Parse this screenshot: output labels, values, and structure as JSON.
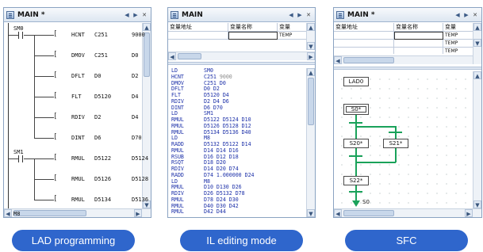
{
  "windows": {
    "lad": {
      "title": "MAIN *",
      "rungs": [
        {
          "label": "SM0",
          "instructions": [
            {
              "op": "HCNT",
              "a": "C251",
              "b": "9000"
            },
            {
              "op": "DMOV",
              "a": "C251",
              "b": "D0"
            },
            {
              "op": "DFLT",
              "a": "D0",
              "b": "D2"
            },
            {
              "op": "FLT",
              "a": "D5120",
              "b": "D4"
            },
            {
              "op": "RDIV",
              "a": "D2",
              "b": "D4"
            },
            {
              "op": "DINT",
              "a": "D6",
              "b": "D70"
            }
          ]
        },
        {
          "label": "SM1",
          "instructions": [
            {
              "op": "RMUL",
              "a": "D5122",
              "b": "D5124"
            },
            {
              "op": "RMUL",
              "a": "D5126",
              "b": "D5128"
            },
            {
              "op": "RMUL",
              "a": "D5134",
              "b": "D5136"
            }
          ]
        },
        {
          "label": "M8",
          "instructions": []
        }
      ]
    },
    "il": {
      "title": "MAIN",
      "col_address": "变量地址",
      "col_name": "变量名称",
      "col_third": "变量",
      "temp_value": "TEMP",
      "lines": [
        {
          "op": "LD",
          "arg": "SM0",
          "extra": ""
        },
        {
          "op": "HCNT",
          "arg": "C251",
          "extra": "9000"
        },
        {
          "op": "DMOV",
          "arg": "C251 D0",
          "extra": ""
        },
        {
          "op": "DFLT",
          "arg": "D0 D2",
          "extra": ""
        },
        {
          "op": "FLT",
          "arg": "D5120 D4",
          "extra": ""
        },
        {
          "op": "RDIV",
          "arg": "D2 D4 D6",
          "extra": ""
        },
        {
          "op": "DINT",
          "arg": "D6 D70",
          "extra": ""
        },
        {
          "op": "LD",
          "arg": "SM1",
          "extra": ""
        },
        {
          "op": "RMUL",
          "arg": "D5122 D5124 D10",
          "extra": ""
        },
        {
          "op": "RMUL",
          "arg": "D5126 D5128 D12",
          "extra": ""
        },
        {
          "op": "RMUL",
          "arg": "D5134 D5136 D40",
          "extra": ""
        },
        {
          "op": "LD",
          "arg": "M8",
          "extra": ""
        },
        {
          "op": "RADD",
          "arg": "D5132 D5122 D14",
          "extra": ""
        },
        {
          "op": "RMUL",
          "arg": "D14 D14 D16",
          "extra": ""
        },
        {
          "op": "RSUB",
          "arg": "D16 D12 D18",
          "extra": ""
        },
        {
          "op": "RSQT",
          "arg": "D18 D20",
          "extra": ""
        },
        {
          "op": "RDIV",
          "arg": "D14 D20 D74",
          "extra": ""
        },
        {
          "op": "RADD",
          "arg": "D74 1.000000 D24",
          "extra": ""
        },
        {
          "op": "LD",
          "arg": "M8",
          "extra": ""
        },
        {
          "op": "RMUL",
          "arg": "D10 D130 D26",
          "extra": ""
        },
        {
          "op": "RDIV",
          "arg": "D26 D5132 D78",
          "extra": ""
        },
        {
          "op": "RMUL",
          "arg": "D78 D24 D30",
          "extra": ""
        },
        {
          "op": "RMUL",
          "arg": "D40 D30 D42",
          "extra": ""
        },
        {
          "op": "RMUL",
          "arg": "D42 D44",
          "extra": ""
        }
      ]
    },
    "sfc": {
      "title": "MAIN *",
      "col_address": "变量地址",
      "col_name": "变量名称",
      "col_third": "变量",
      "temp_rows": [
        "TEMP",
        "TEMP",
        "TEMP"
      ],
      "blocks": {
        "lad0": "LAD0",
        "s0": "S0*",
        "s20": "S20*",
        "s21": "S21*",
        "s22": "S22*",
        "jump": "S0"
      }
    }
  },
  "captions": {
    "lad": "LAD programming",
    "il": "IL editing mode",
    "sfc": "SFC"
  },
  "colors": {
    "caption_bg": "#2f66cc",
    "il_text": "#1b2fa8",
    "sfc_green": "#1aa25a"
  }
}
